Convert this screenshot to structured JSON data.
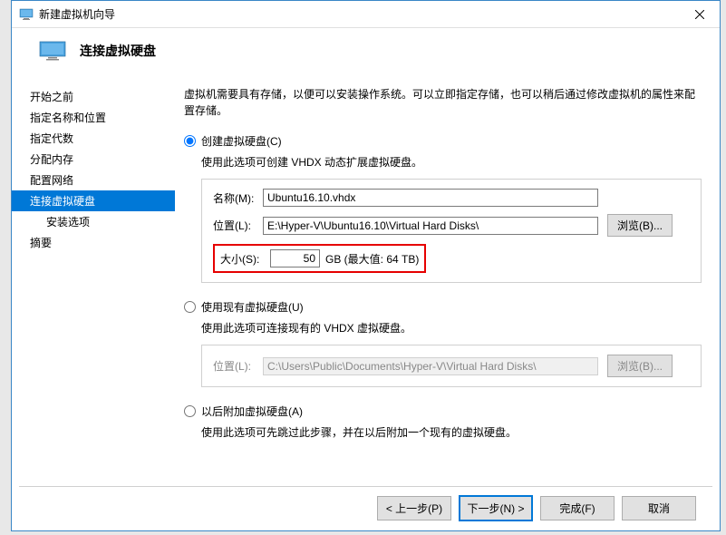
{
  "titlebar": {
    "text": "新建虚拟机向导"
  },
  "header": {
    "title": "连接虚拟硬盘"
  },
  "sidebar": {
    "items": [
      {
        "label": "开始之前"
      },
      {
        "label": "指定名称和位置"
      },
      {
        "label": "指定代数"
      },
      {
        "label": "分配内存"
      },
      {
        "label": "配置网络"
      },
      {
        "label": "连接虚拟硬盘"
      },
      {
        "label": "安装选项"
      },
      {
        "label": "摘要"
      }
    ]
  },
  "content": {
    "intro": "虚拟机需要具有存储，以便可以安装操作系统。可以立即指定存储，也可以稍后通过修改虚拟机的属性来配置存储。",
    "option1": {
      "label": "创建虚拟硬盘(C)",
      "desc": "使用此选项可创建 VHDX 动态扩展虚拟硬盘。",
      "name_label": "名称(M):",
      "name_value": "Ubuntu16.10.vhdx",
      "loc_label": "位置(L):",
      "loc_value": "E:\\Hyper-V\\Ubuntu16.10\\Virtual Hard Disks\\",
      "browse": "浏览(B)...",
      "size_label": "大小(S):",
      "size_value": "50",
      "size_unit": "GB (最大值: 64 TB)"
    },
    "option2": {
      "label": "使用现有虚拟硬盘(U)",
      "desc": "使用此选项可连接现有的 VHDX 虚拟硬盘。",
      "loc_label": "位置(L):",
      "loc_value": "C:\\Users\\Public\\Documents\\Hyper-V\\Virtual Hard Disks\\",
      "browse": "浏览(B)..."
    },
    "option3": {
      "label": "以后附加虚拟硬盘(A)",
      "desc": "使用此选项可先跳过此步骤，并在以后附加一个现有的虚拟硬盘。"
    }
  },
  "footer": {
    "prev": "< 上一步(P)",
    "next": "下一步(N) >",
    "finish": "完成(F)",
    "cancel": "取消"
  }
}
